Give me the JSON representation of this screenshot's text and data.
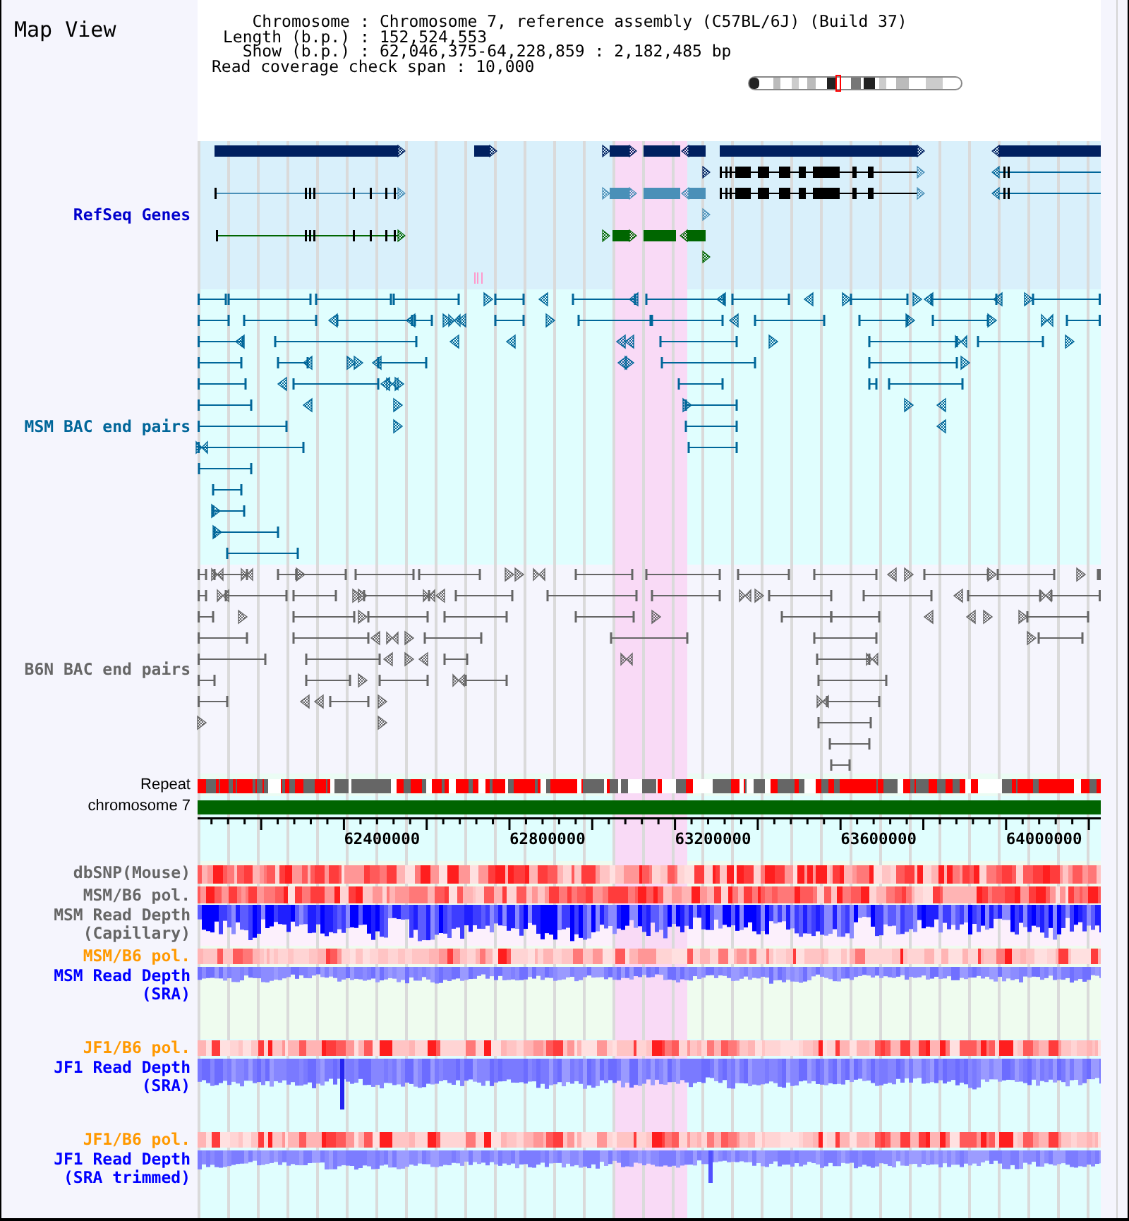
{
  "title": "Map View",
  "info": [
    {
      "label": "Chromosome",
      "separator": ":",
      "value": "Chromosome 7, reference assembly (C57BL/6J) (Build 37)"
    },
    {
      "label": "Length (b.p.)",
      "separator": ":",
      "value": "152,524,553"
    },
    {
      "label": "Show (b.p.)",
      "separator": ":",
      "value": "62,046,375-64,228,859 : 2,182,485 bp"
    }
  ],
  "coverage": {
    "label": "Read coverage check span",
    "separator": ":",
    "value": "10,000"
  },
  "tracks": [
    {
      "kind": "genes",
      "label": "RefSeq Genes",
      "color": "#0000cc"
    },
    {
      "kind": "bac_pairs",
      "label": "MSM BAC end pairs",
      "color": "#006699"
    },
    {
      "kind": "bac_pairs",
      "label": "B6N BAC end pairs",
      "color": "#666666"
    },
    {
      "kind": "repeat",
      "label": "Repeat",
      "color": "#000000"
    },
    {
      "kind": "chromosome",
      "label": "chromosome 7",
      "color": "#000000"
    },
    {
      "kind": "ruler",
      "ticks": [
        "62400000",
        "62800000",
        "63200000",
        "63600000",
        "64000000"
      ]
    },
    {
      "kind": "heat",
      "label": "dbSNP(Mouse)",
      "color": "#666666"
    },
    {
      "kind": "heat",
      "label": "MSM/B6 pol.",
      "color": "#666666"
    },
    {
      "kind": "depth",
      "label": "MSM Read Depth (Capillary)",
      "color": "#666666"
    },
    {
      "kind": "heat",
      "label": "MSM/B6 pol.",
      "color": "#ff9900"
    },
    {
      "kind": "depth",
      "label": "MSM Read Depth (SRA)",
      "color": "#0000ff"
    },
    {
      "kind": "heat",
      "label": "JF1/B6 pol.",
      "color": "#ff9900"
    },
    {
      "kind": "depth",
      "label": "JF1 Read Depth (SRA)",
      "color": "#0000ff"
    },
    {
      "kind": "heat",
      "label": "JF1/B6 pol.",
      "color": "#ff9900"
    },
    {
      "kind": "depth",
      "label": "JF1 Read Depth (SRA trimmed)",
      "color": "#0000ff"
    }
  ]
}
